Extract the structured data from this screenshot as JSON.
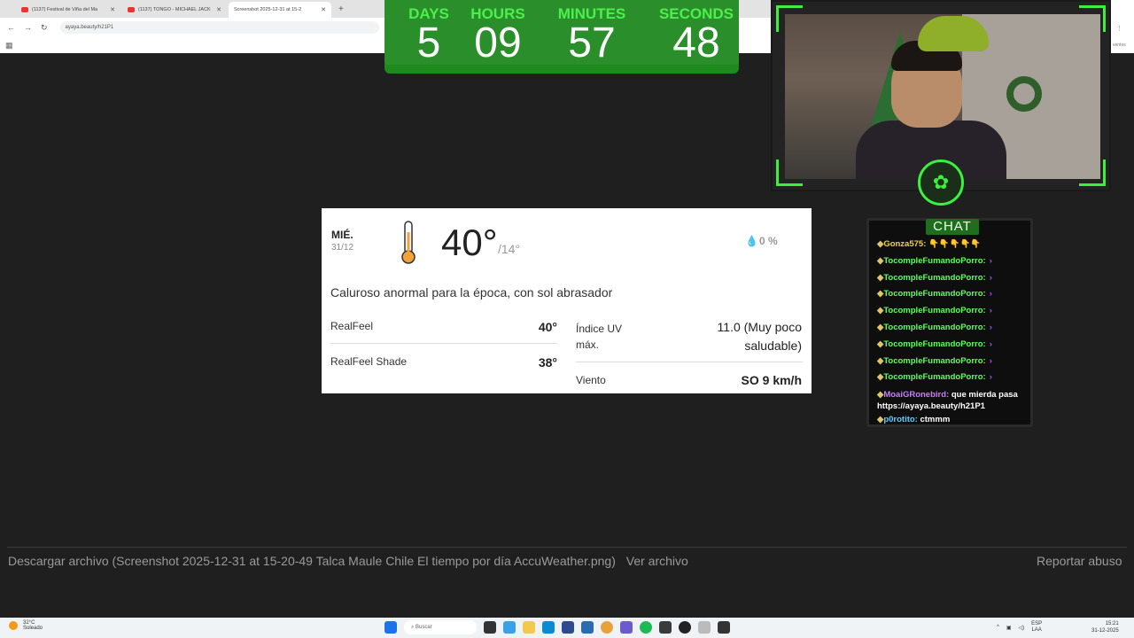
{
  "browser": {
    "tabs": [
      {
        "label": "(1137) Festival de Viña del Ma"
      },
      {
        "label": "(1137) TONGO - MICHAEL JACK"
      },
      {
        "label": "Screenshot 2025-12-31 at 15-2"
      }
    ],
    "new_tab": "+",
    "url": "ayaya.beauty/h21P1",
    "right_fragment": "ventos"
  },
  "countdown": {
    "units": [
      {
        "label": "DAYS",
        "value": "5"
      },
      {
        "label": "HOURS",
        "value": "09"
      },
      {
        "label": "MINUTES",
        "value": "57"
      },
      {
        "label": "SECONDS",
        "value": "48"
      }
    ]
  },
  "weather": {
    "day": "MIÉ.",
    "date": "31/12",
    "temp": "40°",
    "low": "/14°",
    "precip": "0 %",
    "description": "Caluroso anormal para la época, con sol abrasador",
    "realfeel_label": "RealFeel",
    "realfeel_value": "40°",
    "realfeel_shade_label": "RealFeel Shade",
    "realfeel_shade_value": "38°",
    "uv_label": "Índice UV máx.",
    "uv_value": "11.0 (Muy poco saludable)",
    "wind_label": "Viento",
    "wind_value": "SO 9 km/h"
  },
  "chat": {
    "title": "CHAT",
    "messages": [
      {
        "user": "Gonza575:",
        "text": " 👇👇👇👇👇",
        "color": "#f0d24a"
      },
      {
        "user": "TocompleFumandoPorro:",
        "text": "",
        "color": "#5cff5c"
      },
      {
        "user": "TocompleFumandoPorro:",
        "text": "",
        "color": "#5cff5c"
      },
      {
        "user": "TocompleFumandoPorro:",
        "text": "",
        "color": "#5cff5c"
      },
      {
        "user": "TocompleFumandoPorro:",
        "text": "",
        "color": "#5cff5c"
      },
      {
        "user": "TocompleFumandoPorro:",
        "text": "",
        "color": "#5cff5c"
      },
      {
        "user": "TocompleFumandoPorro:",
        "text": "",
        "color": "#5cff5c"
      },
      {
        "user": "TocompleFumandoPorro:",
        "text": "",
        "color": "#5cff5c"
      },
      {
        "user": "TocompleFumandoPorro:",
        "text": "",
        "color": "#5cff5c"
      },
      {
        "user": "MoaiGRonebird:",
        "text": " que mierda pasa https://ayaya.beauty/h21P1",
        "color": "#c77dff"
      },
      {
        "user": "p0rotito:",
        "text": " ctmmm",
        "color": "#5cd0ff"
      }
    ]
  },
  "download": {
    "label": "Descargar archivo (Screenshot 2025-12-31 at 15-20-49 Talca Maule Chile El tiempo por día AccuWeather.png)",
    "open_label": "Ver archivo",
    "report_label": "Reportar abuso"
  },
  "taskbar": {
    "weather_temp": "32°C",
    "weather_text": "Soleado",
    "search_placeholder": "Buscar",
    "lang": "ESP",
    "lang_sub": "LAA",
    "time": "15:21",
    "date": "31-12-2025"
  }
}
